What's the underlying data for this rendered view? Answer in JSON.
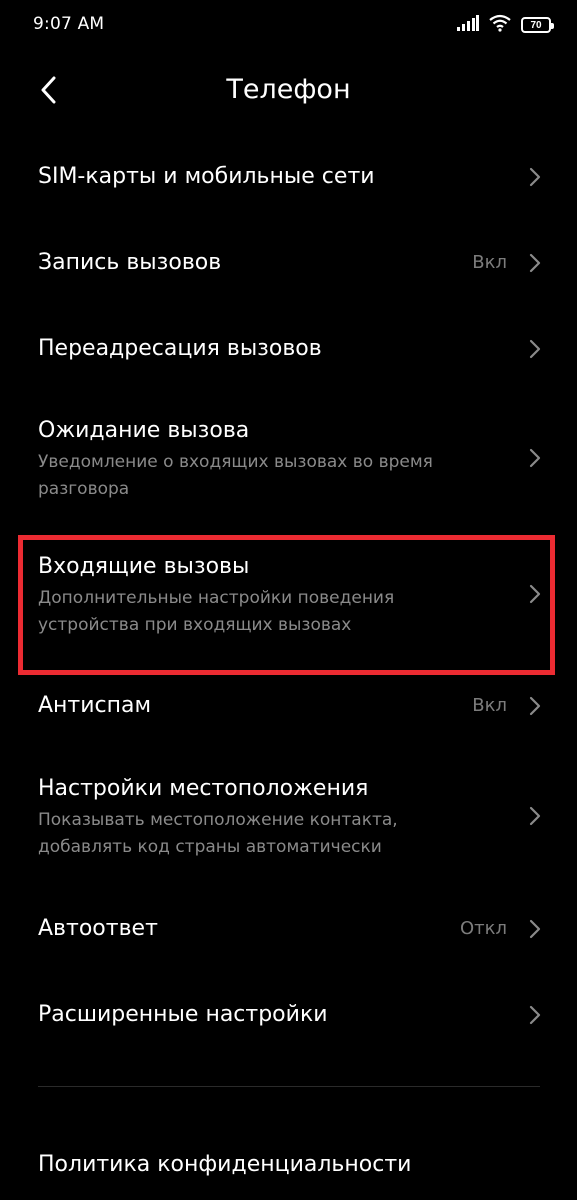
{
  "status_bar": {
    "time": "9:07 AM",
    "battery": "70",
    "icons": [
      "signal-icon",
      "wifi-icon",
      "battery-icon"
    ]
  },
  "header": {
    "title": "Телефон",
    "back_icon": "back-arrow-icon"
  },
  "items": [
    {
      "title": "SIM-карты и мобильные сети"
    },
    {
      "title": "Запись вызовов",
      "value": "Вкл"
    },
    {
      "title": "Переадресация вызовов"
    },
    {
      "title": "Ожидание вызова",
      "subtitle": "Уведомление о входящих вызовах во время разговора"
    },
    {
      "title": "Входящие вызовы",
      "subtitle": "Дополнительные настройки поведения устройства при входящих вызовах",
      "highlighted": true
    },
    {
      "title": "Антиспам",
      "value": "Вкл"
    },
    {
      "title": "Настройки местоположения",
      "subtitle": "Показывать местоположение контакта, добавлять код страны автоматически"
    },
    {
      "title": "Автоответ",
      "value": "Откл"
    },
    {
      "title": "Расширенные настройки"
    }
  ],
  "footer_items": [
    {
      "title": "Политика конфиденциальности"
    }
  ],
  "colors": {
    "background": "#000000",
    "text_primary": "#ffffff",
    "text_secondary": "#8a8a8a",
    "highlight": "#ec2b32"
  }
}
